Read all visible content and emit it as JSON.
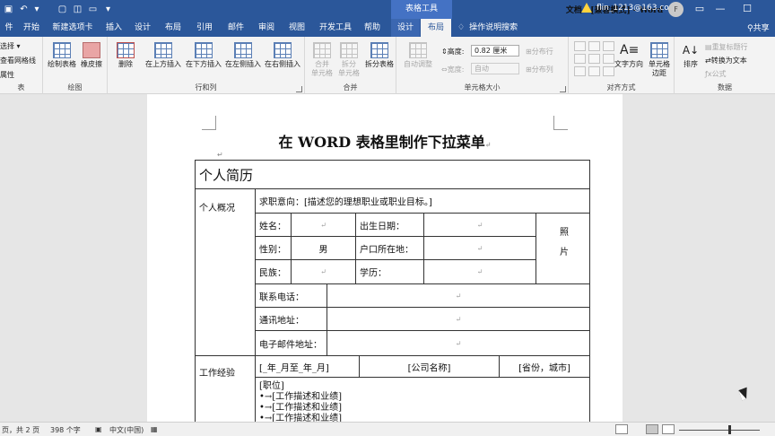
{
  "titlebar": {
    "quick_access_icons": [
      "save-icon",
      "undo-icon",
      "redo-icon",
      "new-doc-icon",
      "print-preview-icon",
      "open-icon",
      "customize-icon"
    ],
    "doc_title": "文档4 [兼容模式] - Word",
    "context_tools_label": "表格工具",
    "account_email": "flin_1213@163.com",
    "avatar_initial": "F",
    "window_controls": [
      "—",
      "☐",
      "✕"
    ],
    "bg_color": "#2b579a"
  },
  "tabs": [
    {
      "label": "开始"
    },
    {
      "label": "新建选项卡"
    },
    {
      "label": "插入"
    },
    {
      "label": "设计"
    },
    {
      "label": "布局"
    },
    {
      "label": "引用"
    },
    {
      "label": "邮件"
    },
    {
      "label": "审阅"
    },
    {
      "label": "视图"
    },
    {
      "label": "开发工具"
    },
    {
      "label": "帮助"
    },
    {
      "label": "设计"
    },
    {
      "label": "布局"
    }
  ],
  "tell_me": "操作说明搜索",
  "share": "共享",
  "ribbon": {
    "table_group": {
      "items": [
        "选择 ▾",
        "查看网格线",
        "属性"
      ],
      "label": "表"
    },
    "draw_group": {
      "draw_table": "绘制表格",
      "eraser": "橡皮擦",
      "label": "绘图"
    },
    "rows_cols_group": {
      "delete": "删除",
      "insert_above": "在上方插入",
      "insert_below": "在下方插入",
      "insert_left": "在左侧插入",
      "insert_right": "在右侧插入",
      "label": "行和列"
    },
    "merge_group": {
      "merge_cells_1": "合并",
      "merge_cells_2": "单元格",
      "split_cells_1": "拆分",
      "split_cells_2": "单元格",
      "split_table": "拆分表格",
      "label": "合并"
    },
    "cell_size_group": {
      "autofit": "自动调整",
      "height_label": "高度:",
      "height_value": "0.82 厘米",
      "width_label": "宽度:",
      "width_value": "自动",
      "distribute_rows": "分布行",
      "distribute_cols": "分布列",
      "label": "单元格大小"
    },
    "alignment_group": {
      "text_direction": "文字方向",
      "cell_margins_1": "单元格",
      "cell_margins_2": "边距",
      "label": "对齐方式"
    },
    "data_group": {
      "sort": "排序",
      "repeat_header": "重复标题行",
      "convert_to_text": "转换为文本",
      "formula": "公式",
      "label": "数据"
    }
  },
  "document": {
    "title": "在 WORD 表格里制作下拉菜单",
    "para_mark": "↵",
    "table": {
      "header": "个人简历",
      "overview_label": "个人概况",
      "objective": "求职意向：[描述您的理想职业或职业目标。]",
      "name_label": "姓名：",
      "birth_label": "出生日期：",
      "photo_label_1": "照",
      "photo_label_2": "片",
      "gender_label": "性别：",
      "gender_value": "男",
      "hukou_label": "户口所在地：",
      "ethnicity_label": "民族：",
      "education_label": "学历：",
      "phone_label": "联系电话：",
      "address_label": "通讯地址：",
      "email_label": "电子邮件地址：",
      "work_label": "工作经验",
      "work_period": "[_年_月至_年_月]",
      "company": "[公司名称]",
      "location": "[省份，城市]",
      "position": "[职位]",
      "duty_1": "•→[工作描述和业绩]",
      "duty_2": "•→[工作描述和业绩]",
      "duty_3": "•→[工作描述和业绩]"
    }
  },
  "status": {
    "page": "页，共 2 页",
    "words": "398 个字",
    "language": "中文(中国)"
  }
}
